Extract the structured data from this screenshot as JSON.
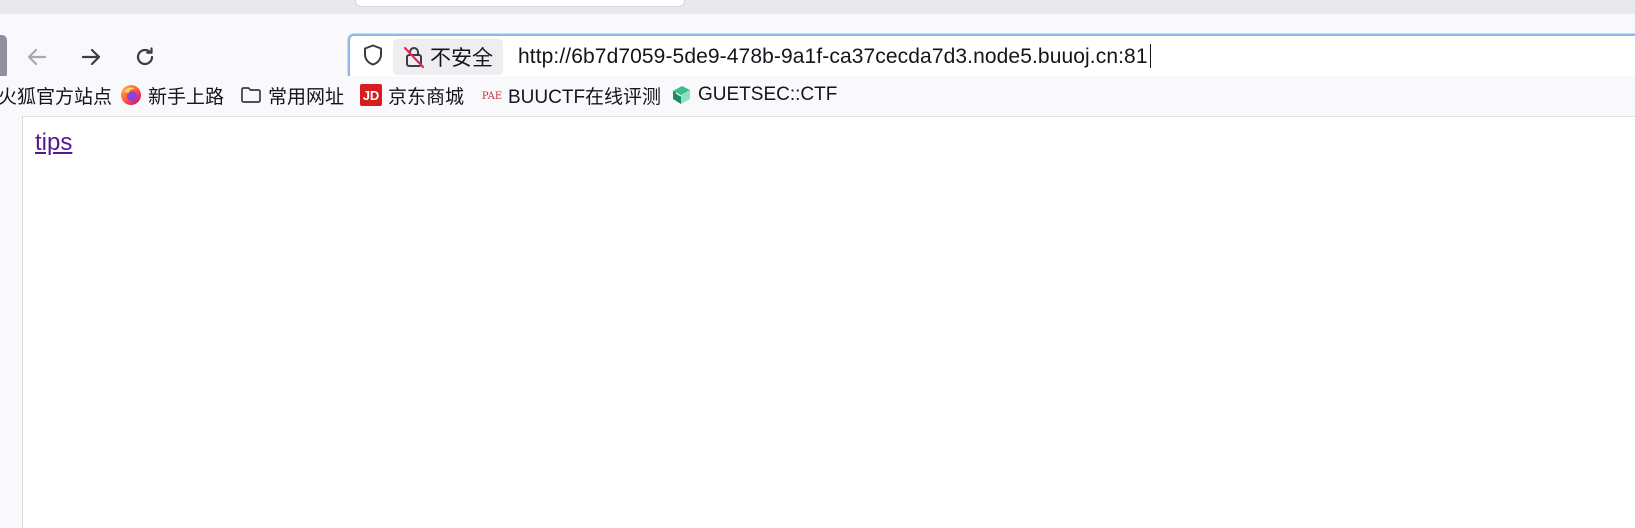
{
  "browser": {
    "toolbar": {
      "back_icon": "arrow-left-icon",
      "forward_icon": "arrow-right-icon",
      "reload_icon": "reload-icon"
    },
    "urlbar": {
      "shield_icon": "shield-icon",
      "security_icon": "lock-slash-icon",
      "security_label": "不安全",
      "url": "http://6b7d7059-5de9-478b-9a1f-ca37cecda7d3.node5.buuoj.cn:81"
    },
    "bookmarks": [
      {
        "label": "火狐官方站点",
        "icon": "firefox-icon"
      },
      {
        "label": "新手上路",
        "icon": "firefox-icon"
      },
      {
        "label": "常用网址",
        "icon": "folder-icon"
      },
      {
        "label": "京东商城",
        "icon": "jd-icon"
      },
      {
        "label": "BUUCTF在线评测",
        "icon": "buuctf-icon"
      },
      {
        "label": "GUETSEC::CTF",
        "icon": "guetsec-icon"
      }
    ]
  },
  "page": {
    "link_text": "tips"
  },
  "colors": {
    "urlbar_border": "#8fb7ee",
    "visited_link": "#551a8b",
    "jd_red": "#d71c1e"
  }
}
